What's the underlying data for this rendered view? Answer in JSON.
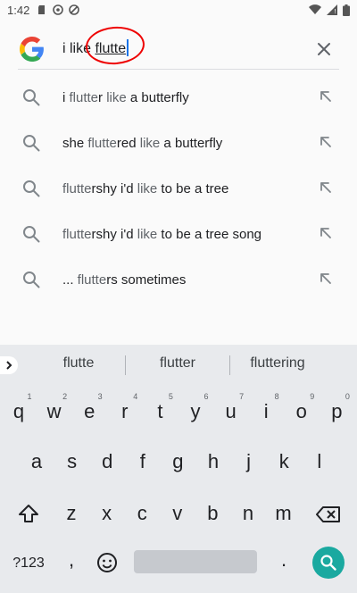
{
  "status_bar": {
    "time": "1:42"
  },
  "search": {
    "prefix": "i like ",
    "typed": "flutte"
  },
  "suggestions": [
    {
      "parts": [
        {
          "t": "i ",
          "typed": false
        },
        {
          "t": "flutte",
          "typed": true
        },
        {
          "t": "r ",
          "typed": false
        },
        {
          "t": "like",
          "typed": true
        },
        {
          "t": " a butterfly",
          "typed": false
        }
      ]
    },
    {
      "parts": [
        {
          "t": "she ",
          "typed": false
        },
        {
          "t": "flutte",
          "typed": true
        },
        {
          "t": "red ",
          "typed": false
        },
        {
          "t": "like",
          "typed": true
        },
        {
          "t": " a butterfly",
          "typed": false
        }
      ]
    },
    {
      "parts": [
        {
          "t": "flutte",
          "typed": true
        },
        {
          "t": "rshy i'd ",
          "typed": false
        },
        {
          "t": "like",
          "typed": true
        },
        {
          "t": " to be a tree",
          "typed": false
        }
      ]
    },
    {
      "parts": [
        {
          "t": "flutte",
          "typed": true
        },
        {
          "t": "rshy i'd ",
          "typed": false
        },
        {
          "t": "like",
          "typed": true
        },
        {
          "t": " to be a tree song",
          "typed": false
        }
      ]
    },
    {
      "parts": [
        {
          "t": "... ",
          "typed": false
        },
        {
          "t": "flutte",
          "typed": true
        },
        {
          "t": "rs sometimes",
          "typed": false
        }
      ]
    }
  ],
  "keyboard": {
    "candidates": [
      "flutte",
      "flutter",
      "fluttering"
    ],
    "row1": [
      "q",
      "w",
      "e",
      "r",
      "t",
      "y",
      "u",
      "i",
      "o",
      "p"
    ],
    "row1_hints": [
      "1",
      "2",
      "3",
      "4",
      "5",
      "6",
      "7",
      "8",
      "9",
      "0"
    ],
    "row2": [
      "a",
      "s",
      "d",
      "f",
      "g",
      "h",
      "j",
      "k",
      "l"
    ],
    "row3": [
      "z",
      "x",
      "c",
      "v",
      "b",
      "n",
      "m"
    ],
    "symbols_label": "?123",
    "comma_label": ",",
    "period_label": "."
  },
  "colors": {
    "accent": "#1a73e8",
    "annotation": "#e00000",
    "go_button": "#1aa9a0"
  }
}
